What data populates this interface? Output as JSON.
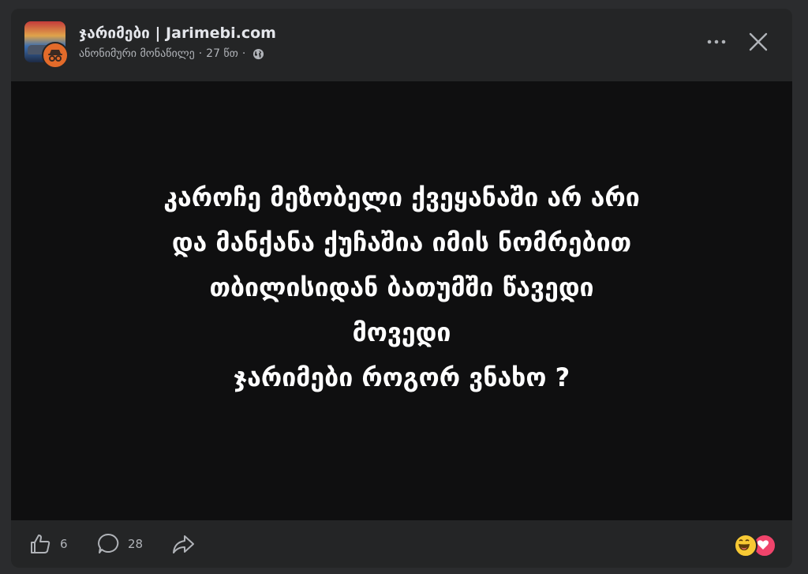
{
  "post": {
    "page_name": "ჯარიმები | Jarimebi.com",
    "author": "ანონიმური მონაწილე",
    "time": "27 წთ",
    "privacy_icon": "globe-icon",
    "text_lines": [
      "კაროჩე მეზობელი ქვეყანაში არ არი",
      "და მანქანა ქუჩაშია იმის ნომრებით",
      "თბილისიდან ბათუმში წავედი",
      "მოვედი",
      "ჯარიმები როგორ ვნახო ?"
    ]
  },
  "header": {
    "more_icon": "more-options-icon",
    "close_icon": "close-icon"
  },
  "footer": {
    "like_icon": "thumbs-up-icon",
    "like_count": "6",
    "comment_icon": "comment-icon",
    "comment_count": "28",
    "share_icon": "share-icon",
    "reactions": [
      "haha-reaction-icon",
      "love-reaction-icon"
    ]
  },
  "colors": {
    "page_bg": "#2b2c2e",
    "card_bg": "#242526",
    "post_bg": "#0f0f10",
    "text_primary": "#e4e6eb",
    "text_secondary": "#b0b3b8",
    "avatar_badge": "#e36b2a",
    "haha": "#f7c934",
    "love": "#f0446b"
  }
}
